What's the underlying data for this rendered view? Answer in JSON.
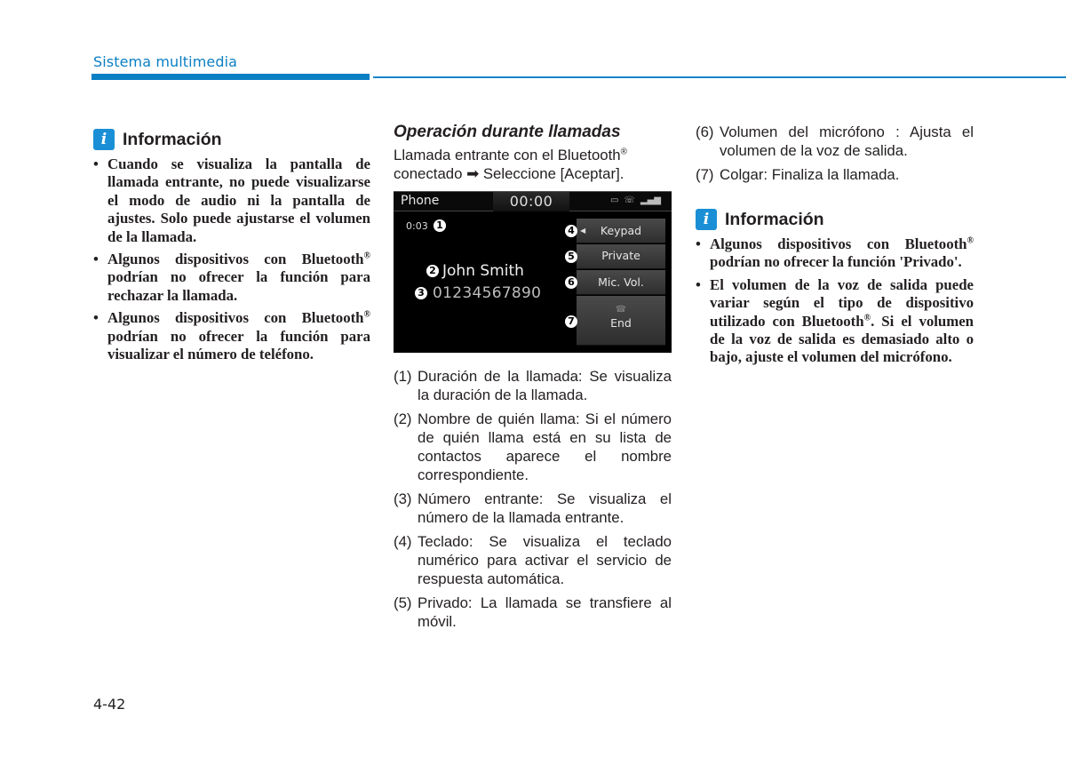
{
  "header": {
    "section_title": "Sistema multimedia",
    "accent_color": "#0a7fc4"
  },
  "left_info": {
    "icon": "info-icon",
    "title": "Información",
    "bullets": [
      "Cuando se visualiza la pantalla de llamada entrante, no puede visualizarse el modo de audio ni la pantalla de ajustes. Solo puede ajustarse el volumen de la llamada.",
      "Algunos dispositivos con Bluetooth® podrían no ofrecer la función para rechazar la llamada.",
      "Algunos dispositivos con Bluetooth® podrían no ofrecer la función para visualizar el número de teléfono."
    ]
  },
  "middle": {
    "section_title": "Operación durante llamadas",
    "intro_line1": "Llamada entrante con el Bluetooth®",
    "intro_line2": "conectado ➡ Seleccione [Aceptar].",
    "screen": {
      "app_label": "Phone",
      "clock": "00:00",
      "status_icons": [
        "battery-icon",
        "bluetooth-phone-icon",
        "signal-icon"
      ],
      "call_duration": "0:03",
      "caller_name": "John Smith",
      "caller_number": "01234567890",
      "buttons": {
        "keypad": "Keypad",
        "private": "Private",
        "mic_vol": "Mic. Vol.",
        "end": "End"
      },
      "callouts": [
        "1",
        "2",
        "3",
        "4",
        "5",
        "6",
        "7"
      ]
    },
    "items": [
      {
        "num": "(1)",
        "text": "Duración de la llamada: Se visualiza la duración de la llamada."
      },
      {
        "num": "(2)",
        "text": "Nombre de quién llama: Si el número de quién llama está en su lista de contactos aparece el nombre correspondiente."
      },
      {
        "num": "(3)",
        "text": "Número entrante: Se visualiza el número de la llamada entrante."
      },
      {
        "num": "(4)",
        "text": "Teclado: Se visualiza el teclado numérico para activar el servicio de respuesta automática."
      },
      {
        "num": "(5)",
        "text": "Privado: La llamada se transfiere al móvil."
      }
    ]
  },
  "right": {
    "items": [
      {
        "num": "(6)",
        "text": "Volumen del micrófono : Ajusta el volumen de la voz de salida."
      },
      {
        "num": "(7)",
        "text": "Colgar: Finaliza la llamada."
      }
    ],
    "info": {
      "icon": "info-icon",
      "title": "Información",
      "bullets": [
        "Algunos dispositivos con Bluetooth® podrían no ofrecer la función 'Privado'.",
        "El volumen de la voz de salida puede variar según el tipo de dispositivo utilizado con Bluetooth®. Si el volumen de la voz de salida es demasiado alto o bajo, ajuste el volumen del micrófono."
      ]
    }
  },
  "footer": {
    "page_number": "4-42"
  }
}
